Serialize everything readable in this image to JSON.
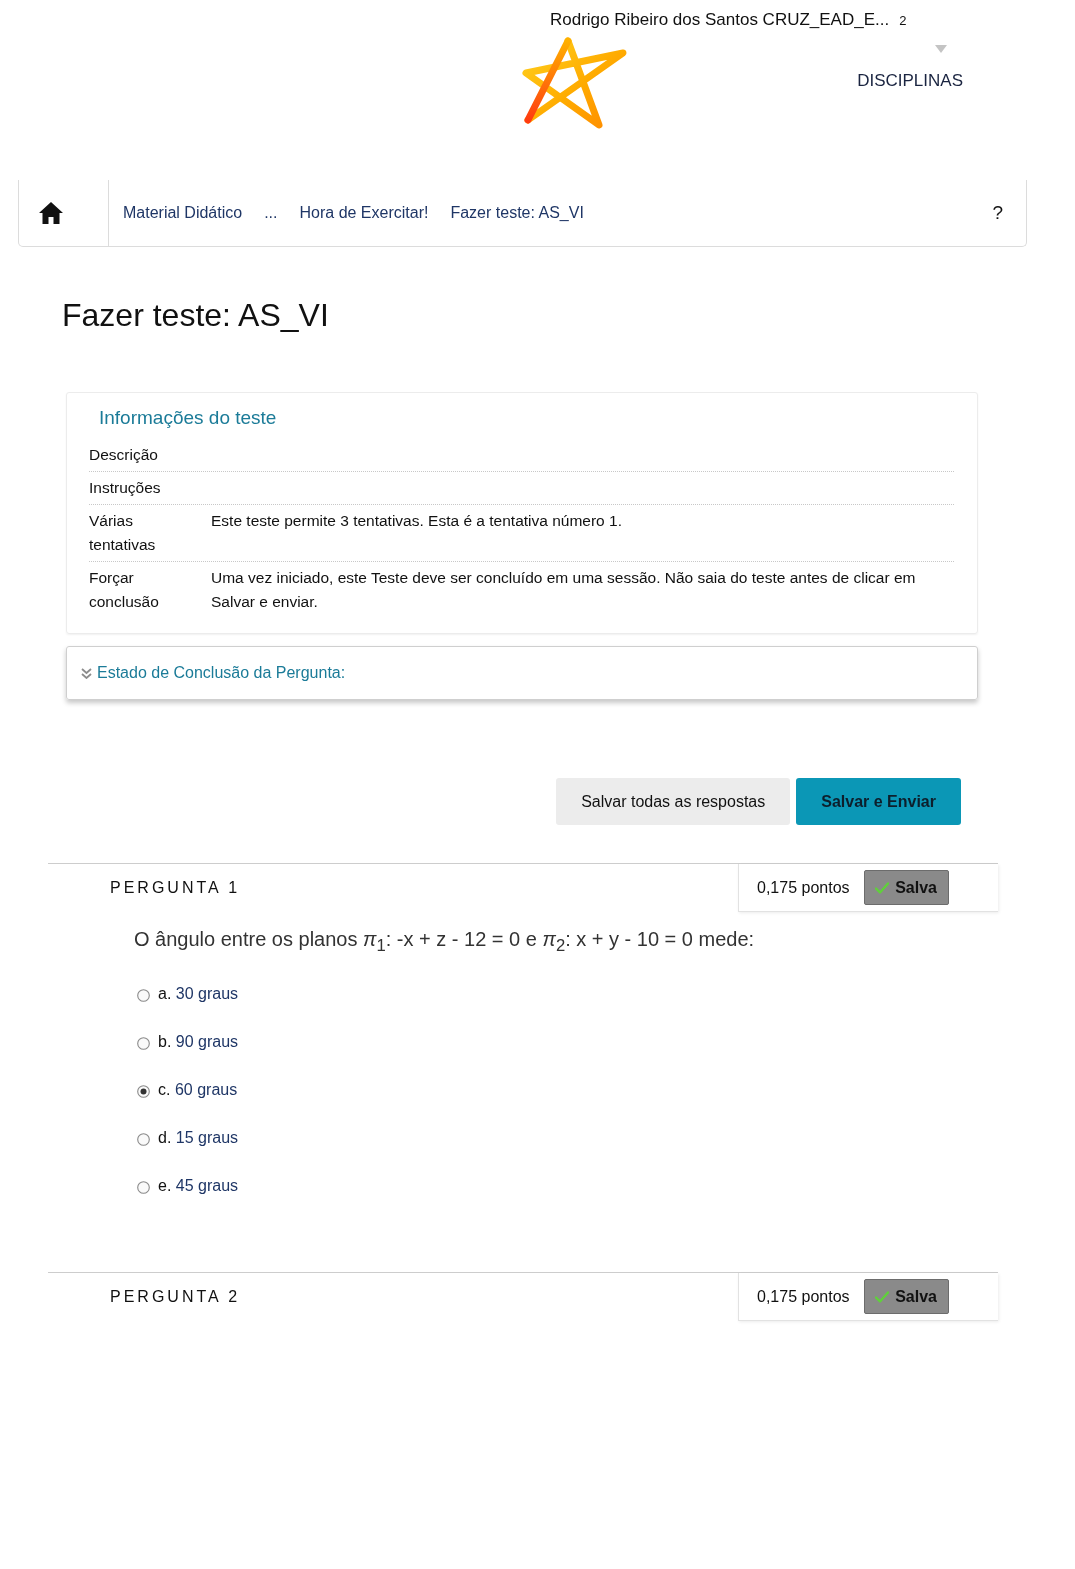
{
  "header": {
    "user_name": "Rodrigo Ribeiro dos Santos CRUZ_EAD_E...",
    "count": "2",
    "nav_link": "DISCIPLINAS"
  },
  "breadcrumb": {
    "items": [
      "Material Didático",
      "...",
      "Hora de Exercitar!",
      "Fazer teste: AS_VI"
    ],
    "help": "?"
  },
  "page_title": "Fazer teste: AS_VI",
  "test_info": {
    "title": "Informações do teste",
    "rows": [
      {
        "label": "Descrição"
      },
      {
        "label": "Instruções"
      },
      {
        "label": "Várias tentativas",
        "value": "Este teste permite 3 tentativas. Esta é a tentativa número 1."
      },
      {
        "label": "Forçar conclusão",
        "value": "Uma vez iniciado, este Teste deve ser concluído em uma sessão. Não saia do teste antes de clicar em Salvar e enviar."
      }
    ]
  },
  "completion_status": {
    "label": "Estado de Conclusão da Pergunta:",
    "expanded": false
  },
  "actions": [
    {
      "label": "Salvar todas as respostas",
      "kind": "secondary"
    },
    {
      "label": "Salvar e Enviar",
      "kind": "primary"
    }
  ],
  "questions": [
    {
      "title": "PERGUNTA 1",
      "points": "0,175 pontos",
      "status": "Salva",
      "prompt": "O ângulo entre os planos *π*$_{1}$: -x + z - 12 = 0 e *π*$_{2}$: x + y - 10 = 0 mede:",
      "options": [
        {
          "letter": "a.",
          "text": "30 graus",
          "selected": false
        },
        {
          "letter": "b.",
          "text": "90 graus",
          "selected": false
        },
        {
          "letter": "c.",
          "text": "60 graus",
          "selected": true
        },
        {
          "letter": "d.",
          "text": "15 graus",
          "selected": false
        },
        {
          "letter": "e.",
          "text": "45 graus",
          "selected": false
        }
      ]
    },
    {
      "title": "PERGUNTA 2",
      "points": "0,175 pontos",
      "status": "Salva"
    }
  ]
}
